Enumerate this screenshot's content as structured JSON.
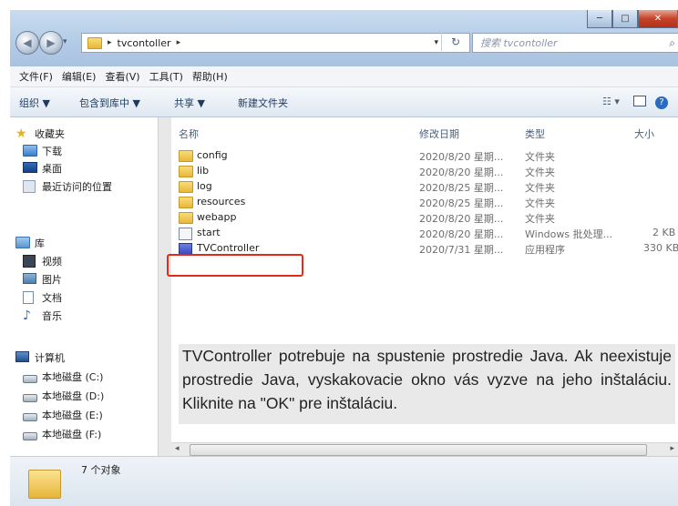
{
  "titlebar": {
    "breadcrumb": "tvcontoller",
    "search_placeholder": "搜索 tvcontoller",
    "buttons": {
      "minimize": "─",
      "maximize": "□",
      "close": "✕"
    }
  },
  "menu": [
    "文件(F)",
    "编辑(E)",
    "查看(V)",
    "工具(T)",
    "帮助(H)"
  ],
  "toolbar": {
    "organize": "组织 ▼",
    "include_library": "包含到库中 ▼",
    "share": "共享 ▼",
    "new_folder": "新建文件夹"
  },
  "sidebar": {
    "favorites": "收藏夹",
    "downloads": "下载",
    "desktop": "桌面",
    "recent": "最近访问的位置",
    "libraries": "库",
    "videos": "视频",
    "pictures": "图片",
    "documents": "文档",
    "music": "音乐",
    "computer": "计算机",
    "drive_c": "本地磁盘 (C:)",
    "drive_d": "本地磁盘 (D:)",
    "drive_e": "本地磁盘 (E:)",
    "drive_f": "本地磁盘 (F:)"
  },
  "columns": {
    "name": "名称",
    "modified": "修改日期",
    "type": "类型",
    "size": "大小"
  },
  "files": [
    {
      "name": "config",
      "modified": "2020/8/20 星期...",
      "type": "文件夹",
      "size": ""
    },
    {
      "name": "lib",
      "modified": "2020/8/20 星期...",
      "type": "文件夹",
      "size": ""
    },
    {
      "name": "log",
      "modified": "2020/8/25 星期...",
      "type": "文件夹",
      "size": ""
    },
    {
      "name": "resources",
      "modified": "2020/8/25 星期...",
      "type": "文件夹",
      "size": ""
    },
    {
      "name": "webapp",
      "modified": "2020/8/20 星期...",
      "type": "文件夹",
      "size": ""
    },
    {
      "name": "start",
      "modified": "2020/8/20 星期...",
      "type": "Windows 批处理...",
      "size": "2 KB"
    },
    {
      "name": "TVController",
      "modified": "2020/7/31 星期...",
      "type": "应用程序",
      "size": "330 KB"
    }
  ],
  "status": {
    "count": "7 个对象"
  },
  "note": "TVController potrebuje na spustenie prostredie Java. Ak neexistuje prostredie Java, vyskakovacie okno vás vyzve na jeho inštaláciu. Kliknite na \"OK\" pre inštaláciu."
}
